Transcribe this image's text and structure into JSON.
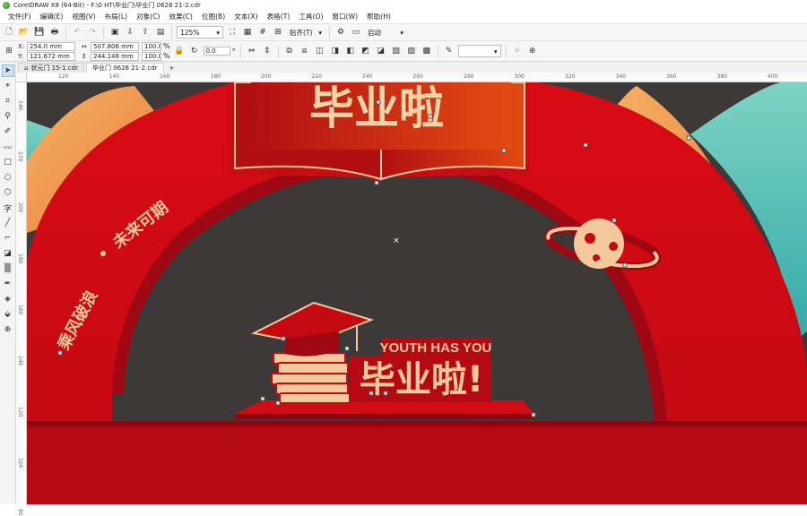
{
  "window": {
    "title": "CorelDRAW X8 (64-Bit) - F:\\0 HT\\毕业门\\毕业门 0628 21-2.cdr"
  },
  "menu": [
    "文件(F)",
    "编辑(E)",
    "视图(V)",
    "布局(L)",
    "对象(C)",
    "效果(C)",
    "位图(B)",
    "文本(X)",
    "表格(T)",
    "工具(O)",
    "窗口(W)",
    "帮助(H)"
  ],
  "toolbar": {
    "zoom": "125%",
    "snap_label": "贴齐(T)",
    "launch_label": "启动"
  },
  "properties": {
    "x": "254.0 mm",
    "y": "121.672 mm",
    "width": "507.806 mm",
    "height": "244.148 mm",
    "scale_x": "100.0",
    "scale_y": "100.0",
    "percent": "%",
    "rotation": "0.0",
    "degree": "°",
    "x_label": "X:",
    "y_label": "Y:"
  },
  "tabs": [
    {
      "label": "状元门 15-1.cdr",
      "active": false
    },
    {
      "label": "毕业门 0628 21-2.cdr",
      "active": true
    }
  ],
  "ruler": {
    "top": [
      "120",
      "140",
      "160",
      "180",
      "200",
      "220",
      "240",
      "260",
      "280",
      "300",
      "320",
      "340",
      "360",
      "380",
      "400"
    ],
    "left": [
      "240",
      "220",
      "200",
      "180",
      "160",
      "140",
      "120",
      "100",
      "80"
    ]
  },
  "artwork": {
    "top_banner": "毕业啦",
    "arch_slogan_1": "乘风破浪",
    "arch_slogan_2": "未来可期",
    "youth_text": "YOUTH HAS YOU",
    "grad_text": "毕业啦!"
  },
  "colors": {
    "background": "#3d3939",
    "arch_red": "#cf0a14",
    "dark_red": "#9e0812",
    "orange": "#f2a45a",
    "teal": "#4fc3b6",
    "gold": "#f3c89a",
    "floor": "#b50a14"
  },
  "icons": [
    "new-file-icon",
    "open-icon",
    "save-icon",
    "print-icon",
    "undo-icon",
    "redo-icon",
    "import-icon",
    "export-icon",
    "publish-icon",
    "gear-icon",
    "pick-tool-icon",
    "shape-tool-icon",
    "crop-tool-icon",
    "zoom-tool-icon",
    "freehand-tool-icon",
    "rectangle-tool-icon",
    "ellipse-tool-icon",
    "polygon-tool-icon",
    "text-tool-icon",
    "line-tool-icon",
    "fill-tool-icon",
    "eyedropper-icon",
    "transparency-icon",
    "add-tool-icon"
  ]
}
